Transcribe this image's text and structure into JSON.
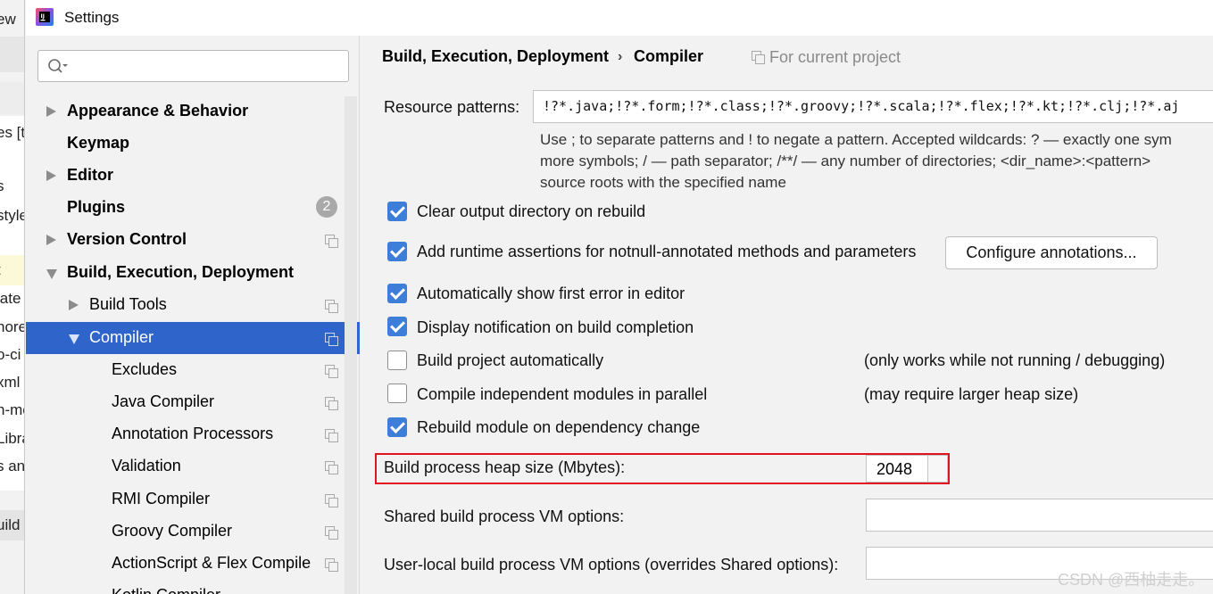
{
  "window": {
    "title": "Settings"
  },
  "background_window": {
    "texts": [
      "ew",
      "es [t",
      "s",
      "style",
      "t",
      "late",
      "nore",
      "o-ci",
      "xml",
      "n-me",
      "Libra",
      "s and",
      "uild"
    ]
  },
  "sidebar": {
    "search_placeholder": "",
    "badge": "2",
    "items": [
      {
        "label": "Appearance & Behavior"
      },
      {
        "label": "Keymap"
      },
      {
        "label": "Editor"
      },
      {
        "label": "Plugins"
      },
      {
        "label": "Version Control"
      },
      {
        "label": "Build, Execution, Deployment"
      },
      {
        "label": "Build Tools"
      },
      {
        "label": "Compiler"
      },
      {
        "label": "Excludes"
      },
      {
        "label": "Java Compiler"
      },
      {
        "label": "Annotation Processors"
      },
      {
        "label": "Validation"
      },
      {
        "label": "RMI Compiler"
      },
      {
        "label": "Groovy Compiler"
      },
      {
        "label": "ActionScript & Flex Compile"
      },
      {
        "label": "Kotlin Compiler"
      }
    ]
  },
  "main": {
    "breadcrumb_1": "Build, Execution, Deployment",
    "breadcrumb_sep": "›",
    "breadcrumb_2": "Compiler",
    "scope": "For current project",
    "resource_patterns_label": "Resource patterns:",
    "resource_patterns_value": "!?*.java;!?*.form;!?*.class;!?*.groovy;!?*.scala;!?*.flex;!?*.kt;!?*.clj;!?*.aj",
    "hint_line1": "Use ; to separate patterns and ! to negate a pattern. Accepted wildcards: ? — exactly one sym",
    "hint_line2": "more symbols; / — path separator; /**/ — any number of directories;  <dir_name>:<pattern>",
    "hint_line3": "source roots with the specified name",
    "options": [
      {
        "label": "Clear output directory on rebuild",
        "checked": true,
        "note": ""
      },
      {
        "label": "Add runtime assertions for notnull-annotated methods and parameters",
        "checked": true,
        "note": ""
      },
      {
        "label": "Automatically show first error in editor",
        "checked": true,
        "note": ""
      },
      {
        "label": "Display notification on build completion",
        "checked": true,
        "note": ""
      },
      {
        "label": "Build project automatically",
        "checked": false,
        "note": "(only works while not running / debugging)"
      },
      {
        "label": "Compile independent modules in parallel",
        "checked": false,
        "note": "(may require larger heap size)"
      },
      {
        "label": "Rebuild module on dependency change",
        "checked": true,
        "note": ""
      }
    ],
    "configure_button": "Configure annotations...",
    "heap_label": "Build process heap size (Mbytes):",
    "heap_value": "2048",
    "shared_vm_label": "Shared build process VM options:",
    "shared_vm_value": "",
    "user_vm_label": "User-local build process VM options (overrides Shared options):",
    "user_vm_value": ""
  },
  "watermark": "CSDN @西柚走走。",
  "colors": {
    "selection": "#2f65ca",
    "checkbox": "#3d7ed8",
    "highlight_box": "#e0141f"
  }
}
